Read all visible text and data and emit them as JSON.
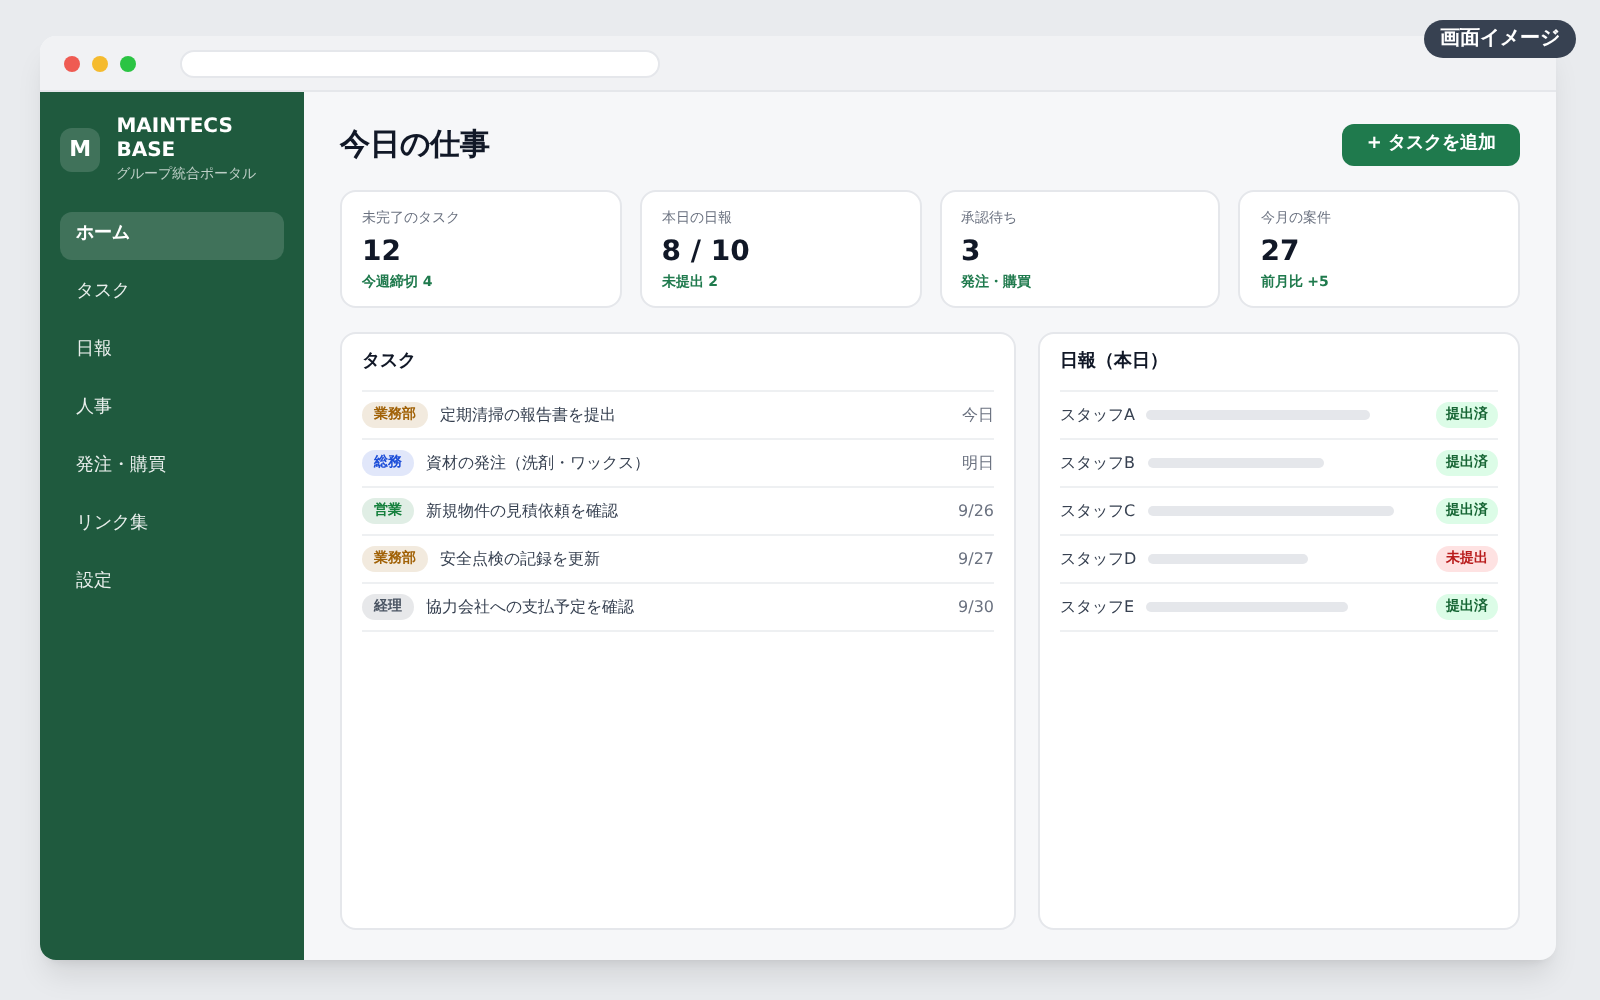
{
  "badge": "画面イメージ",
  "sidebar": {
    "logo_letter": "M",
    "brand": "MAINTECS BASE",
    "subtitle": "グループ統合ポータル",
    "items": [
      {
        "label": "ホーム",
        "selected": true
      },
      {
        "label": "タスク",
        "selected": false
      },
      {
        "label": "日報",
        "selected": false
      },
      {
        "label": "人事",
        "selected": false
      },
      {
        "label": "発注・購買",
        "selected": false
      },
      {
        "label": "リンク集",
        "selected": false
      },
      {
        "label": "設定",
        "selected": false
      }
    ]
  },
  "page_title": "今日の仕事",
  "add_button": "+ タスクを追加",
  "stats": [
    {
      "label": "未完了のタスク",
      "value": "12",
      "note": "今週締切 4"
    },
    {
      "label": "本日の日報",
      "value": "8 / 10",
      "note": "未提出 2"
    },
    {
      "label": "承認待ち",
      "value": "3",
      "note": "発注・購買"
    },
    {
      "label": "今月の案件",
      "value": "27",
      "note": "前月比 +5"
    }
  ],
  "tasks": {
    "title": "タスク",
    "rows": [
      {
        "tag": "業務部",
        "color": "#a16207",
        "text": "定期清掃の報告書を提出",
        "due": "今日"
      },
      {
        "tag": "総務",
        "color": "#1d4ed8",
        "text": "資材の発注（洗剤・ワックス）",
        "due": "明日"
      },
      {
        "tag": "営業",
        "color": "#15803d",
        "text": "新規物件の見積依頼を確認",
        "due": "9/26"
      },
      {
        "tag": "業務部",
        "color": "#a16207",
        "text": "安全点検の記録を更新",
        "due": "9/27"
      },
      {
        "tag": "経理",
        "color": "#4b5563",
        "text": "協力会社への支払予定を確認",
        "due": "9/30"
      }
    ]
  },
  "reports": {
    "title": "日報（本日）",
    "rows": [
      {
        "name": "スタッフA",
        "status": "提出済",
        "submitted": true
      },
      {
        "name": "スタッフB",
        "status": "提出済",
        "submitted": true
      },
      {
        "name": "スタッフC",
        "status": "提出済",
        "submitted": true
      },
      {
        "name": "スタッフD",
        "status": "未提出",
        "submitted": false
      },
      {
        "name": "スタッフE",
        "status": "提出済",
        "submitted": true
      }
    ]
  }
}
